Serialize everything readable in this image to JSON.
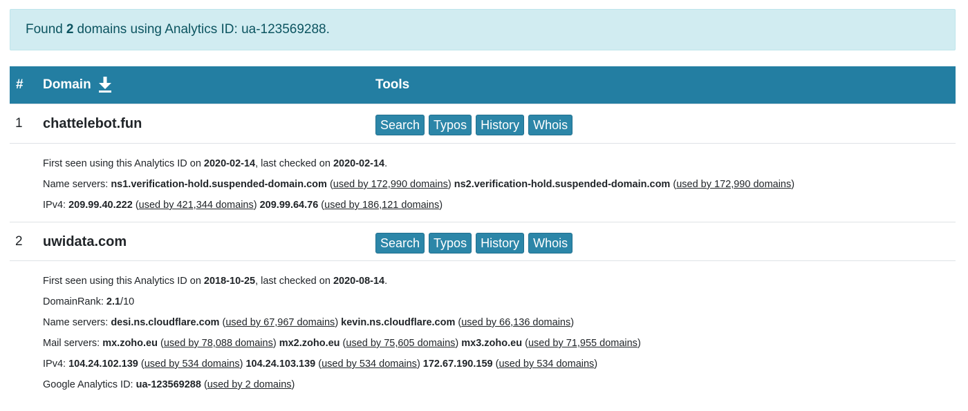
{
  "alert": {
    "prefix": "Found",
    "count": "2",
    "suffix": "domains using Analytics ID: ua-123569288."
  },
  "table": {
    "headers": {
      "num": "#",
      "domain": "Domain",
      "tools": "Tools"
    },
    "download_icon": "download-arrow-icon"
  },
  "tool_buttons": [
    "Search",
    "Typos",
    "History",
    "Whois"
  ],
  "rows": [
    {
      "num": "1",
      "domain": "chattelebot.fun",
      "first_seen_label": "First seen using this Analytics ID on",
      "first_seen": "2020-02-14",
      "last_checked_label": ", last checked on",
      "last_checked": "2020-02-14",
      "ns_label": "Name servers:",
      "ns": [
        {
          "host": "ns1.verification-hold.suspended-domain.com",
          "used": "used by 172,990 domains"
        },
        {
          "host": "ns2.verification-hold.suspended-domain.com",
          "used": "used by 172,990 domains"
        }
      ],
      "ipv4_label": "IPv4:",
      "ipv4": [
        {
          "host": "209.99.40.222",
          "used": "used by 421,344 domains"
        },
        {
          "host": "209.99.64.76",
          "used": "used by 186,121 domains"
        }
      ]
    },
    {
      "num": "2",
      "domain": "uwidata.com",
      "first_seen_label": "First seen using this Analytics ID on",
      "first_seen": "2018-10-25",
      "last_checked_label": ", last checked on",
      "last_checked": "2020-08-14",
      "rank_label": "DomainRank:",
      "rank_value": "2.1",
      "rank_suffix": "/10",
      "ns_label": "Name servers:",
      "ns": [
        {
          "host": "desi.ns.cloudflare.com",
          "used": "used by 67,967 domains"
        },
        {
          "host": "kevin.ns.cloudflare.com",
          "used": "used by 66,136 domains"
        }
      ],
      "mx_label": "Mail servers:",
      "mx": [
        {
          "host": "mx.zoho.eu",
          "used": "used by 78,088 domains"
        },
        {
          "host": "mx2.zoho.eu",
          "used": "used by 75,605 domains"
        },
        {
          "host": "mx3.zoho.eu",
          "used": "used by 71,955 domains"
        }
      ],
      "ipv4_label": "IPv4:",
      "ipv4": [
        {
          "host": "104.24.102.139",
          "used": "used by 534 domains"
        },
        {
          "host": "104.24.103.139",
          "used": "used by 534 domains"
        },
        {
          "host": "172.67.190.159",
          "used": "used by 534 domains"
        }
      ],
      "ga_label": "Google Analytics ID:",
      "ga": [
        {
          "host": "ua-123569288",
          "used": "used by 2 domains"
        }
      ]
    }
  ],
  "colors": {
    "header_bg": "#237ea2",
    "button_bg": "#2c86a8",
    "alert_bg": "#d1ecf1",
    "alert_text": "#0c5460"
  }
}
